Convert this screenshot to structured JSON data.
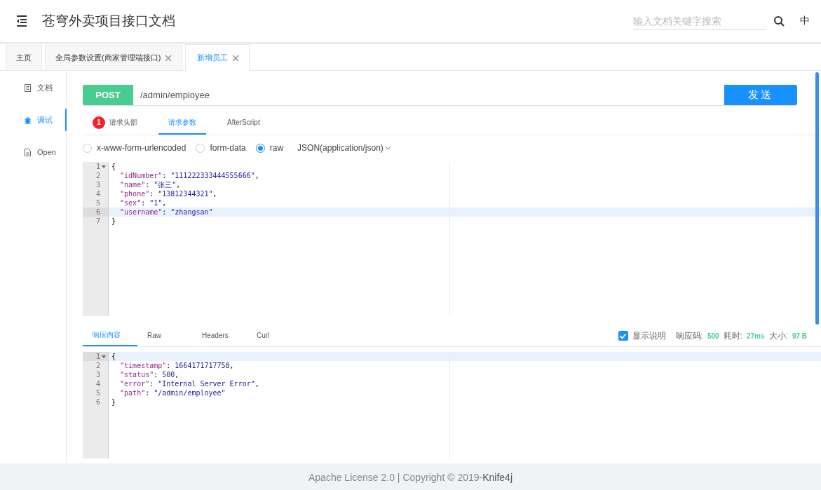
{
  "header": {
    "title": "苍穹外卖项目接口文档",
    "search": {
      "placeholder": "输入文档关键字搜索"
    },
    "language": "中"
  },
  "tabs": [
    {
      "label": "主页",
      "selected": false,
      "closable": false
    },
    {
      "label": "全局参数设置(商家管理端接口)",
      "selected": false,
      "closable": true
    },
    {
      "label": "新增员工",
      "selected": true,
      "closable": true
    }
  ],
  "sidebar": {
    "items": [
      {
        "label": "文档",
        "selected": false,
        "kind": "doc"
      },
      {
        "label": "调试",
        "selected": true,
        "kind": "bug"
      },
      {
        "label": "Open",
        "selected": false,
        "kind": "file"
      }
    ]
  },
  "request": {
    "method": "POST",
    "url": "/admin/employee",
    "send": "发送",
    "tabs": [
      {
        "label": "请求头部",
        "badge": "1",
        "selected": false
      },
      {
        "label": "请求参数",
        "selected": true
      },
      {
        "label": "AfterScript",
        "selected": false
      }
    ],
    "body_types": [
      {
        "label": "x-www-form-urlencoded",
        "selected": false
      },
      {
        "label": "form-data",
        "selected": false
      },
      {
        "label": "raw",
        "selected": true
      }
    ],
    "content_type": "JSON(application/json)",
    "editor": {
      "lines": [
        {
          "number": "1",
          "text": "{",
          "active": false,
          "foldable": true
        },
        {
          "number": "2",
          "text": "  \"idNumber\": \"111222333444555666\",",
          "active": false,
          "foldable": false
        },
        {
          "number": "3",
          "text": "  \"name\": \"张三\",",
          "active": false,
          "foldable": false
        },
        {
          "number": "4",
          "text": "  \"phone\": \"13812344321\",",
          "active": false,
          "foldable": false
        },
        {
          "number": "5",
          "text": "  \"sex\": \"1\",",
          "active": false,
          "foldable": false
        },
        {
          "number": "6",
          "text": "  \"username\": \"zhangsan\"",
          "active": true,
          "foldable": false
        },
        {
          "number": "7",
          "text": "}",
          "active": false,
          "foldable": false
        }
      ]
    }
  },
  "response": {
    "tabs": [
      {
        "label": "响应内容",
        "selected": true
      },
      {
        "label": "Raw",
        "selected": false
      },
      {
        "label": "Headers",
        "selected": false
      },
      {
        "label": "Curl",
        "selected": false
      }
    ],
    "show_description": {
      "label": "显示说明",
      "checked": true
    },
    "stats": [
      {
        "label": "响应码:",
        "value": "500"
      },
      {
        "label": "耗时:",
        "value": "27ms"
      },
      {
        "label": "大小:",
        "value": "97 B"
      }
    ],
    "editor": {
      "lines": [
        {
          "number": "1",
          "text": "{",
          "active": true,
          "foldable": true
        },
        {
          "number": "2",
          "text": "  \"timestamp\": 1664171717758,",
          "active": false,
          "foldable": false
        },
        {
          "number": "3",
          "text": "  \"status\": 500,",
          "active": false,
          "foldable": false
        },
        {
          "number": "4",
          "text": "  \"error\": \"Internal Server Error\",",
          "active": false,
          "foldable": false
        },
        {
          "number": "5",
          "text": "  \"path\": \"/admin/employee\"",
          "active": false,
          "foldable": false
        },
        {
          "number": "6",
          "text": "}",
          "active": false,
          "foldable": false
        }
      ]
    }
  },
  "footer": {
    "text": "Apache License 2.0 | Copyright © 2019-**Knife4j**"
  }
}
